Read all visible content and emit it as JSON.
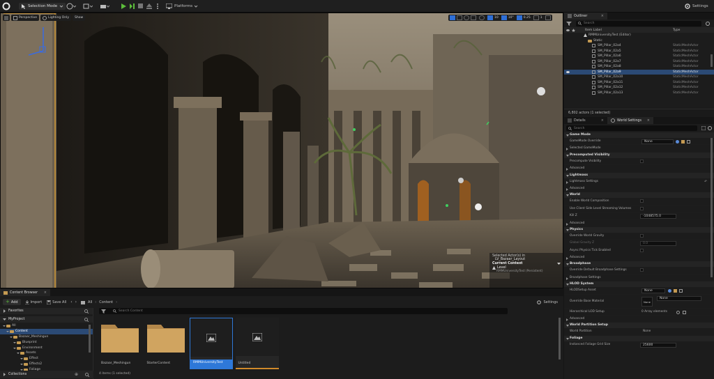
{
  "toolbar": {
    "mode": "Selection Mode",
    "platforms": "Platforms",
    "settings": "Settings"
  },
  "viewport": {
    "perspective": "Perspective",
    "lighting": "Lighting Only",
    "show": "Show",
    "grid_snap": "10",
    "rot_snap": "10°",
    "scale_snap": "0.25",
    "cam_speed": "1",
    "overlay": {
      "selected": "Selected Actor(s) in",
      "level_name": "LV_Bazaar_Layout",
      "context": "Current Context",
      "level": "Level",
      "level_path": "RMMUniversityTest (Persistent)"
    }
  },
  "outliner": {
    "tab": "Outliner",
    "search": "Search",
    "col_label": "Item Label",
    "col_type": "Type",
    "root": "RMMUniversityTest (Editor)",
    "folder": "Static",
    "rows": [
      {
        "name": "SM_Pillar_02a4",
        "type": "StaticMeshActor"
      },
      {
        "name": "SM_Pillar_02a5",
        "type": "StaticMeshActor"
      },
      {
        "name": "SM_Pillar_02a6",
        "type": "StaticMeshActor"
      },
      {
        "name": "SM_Pillar_02a7",
        "type": "StaticMeshActor"
      },
      {
        "name": "SM_Pillar_02a8",
        "type": "StaticMeshActor"
      },
      {
        "name": "SM_Pillar_02a9",
        "type": "StaticMeshActor"
      },
      {
        "name": "SM_Pillar_02a10",
        "type": "StaticMeshActor"
      },
      {
        "name": "SM_Pillar_02a11",
        "type": "StaticMeshActor"
      },
      {
        "name": "SM_Pillar_02a12",
        "type": "StaticMeshActor"
      },
      {
        "name": "SM_Pillar_02a13",
        "type": "StaticMeshActor"
      }
    ],
    "status": "6,802 actors (1 selected)"
  },
  "details": {
    "tab1": "Details",
    "tab2": "World Settings",
    "search": "Search",
    "game_mode": "Game Mode",
    "gamemode_override": "GameMode Override",
    "gamemode_value": "None",
    "selected_gamemode": "Selected GameMode",
    "precomputed": "Precomputed Visibility",
    "precomputed_vis": "Precompute Visibility",
    "advanced": "Advanced",
    "lightmass": "Lightmass",
    "lightmass_settings": "Lightmass Settings",
    "world": "World",
    "enable_comp": "Enable World Composition",
    "client_stream": "Use Client Side Level Streaming Volumes",
    "killz": "Kill Z",
    "killz_value": "-1048575.0",
    "physics": "Physics",
    "override_grav": "Override World Gravity",
    "global_grav": "Global Gravity Z",
    "global_grav_value": "0.0",
    "async_phys": "Async Physics Tick Enabled",
    "broadphase": "Broadphase",
    "override_bp": "Override Default Broadphase Settings",
    "bp_settings": "Broadphase Settings",
    "hlod": "HLOD System",
    "hlod_setup": "HLODSetup Asset",
    "hlod_setup_value": "None",
    "override_base": "Override Base Material",
    "override_base_value": "None",
    "override_thumb": "None",
    "hier_lod": "Hierarchical LOD Setup",
    "hier_lod_value": "0 Array elements",
    "wp": "World Partition Setup",
    "wp_label": "World Partition",
    "wp_value": "None",
    "foliage": "Foliage",
    "foliage_grid": "Instanced Foliage Grid Size",
    "foliage_value": "25600"
  },
  "content": {
    "tab": "Content Browser",
    "add": "Add",
    "import": "Import",
    "save_all": "Save All",
    "crumb_all": "All",
    "crumb_content": "Content",
    "settings": "Settings",
    "search": "Search Content",
    "favorites": "Favorites",
    "project": "MyProject",
    "tree": [
      {
        "label": "All",
        "depth": 0
      },
      {
        "label": "Content",
        "depth": 1
      },
      {
        "label": "Bazaar_Meshingun",
        "depth": 2
      },
      {
        "label": "Blueprint",
        "depth": 3
      },
      {
        "label": "Environment",
        "depth": 3
      },
      {
        "label": "Assets",
        "depth": 4
      },
      {
        "label": "Effect",
        "depth": 5
      },
      {
        "label": "Effects2",
        "depth": 5
      },
      {
        "label": "Foliage",
        "depth": 5
      }
    ],
    "collections": "Collections",
    "assets": [
      {
        "name": "Bazaar_Meshingun",
        "kind": "folder"
      },
      {
        "name": "StarterContent",
        "kind": "folder"
      },
      {
        "name": "RMMUniversityTest",
        "kind": "level"
      },
      {
        "name": "Untitled",
        "kind": "level"
      }
    ],
    "status": "4 items (1 selected)"
  }
}
